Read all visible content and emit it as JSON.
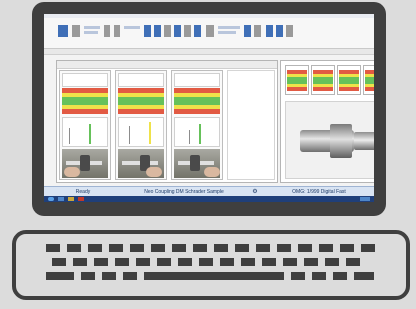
{
  "status_bar": {
    "ready": "Ready",
    "document": "Neo Coupling DM Schrader Sample",
    "instrument": "OMG: 1/999 Digital Fast"
  },
  "colors": {
    "laptop_frame": "#3f3f3f",
    "ribbon_accent": "#3f6fb7",
    "spc_red": "#e25a43",
    "spc_yellow": "#efe24a",
    "spc_green": "#66c15a",
    "taskbar": "#1f3f7a"
  },
  "icons": [
    "laptop",
    "keyboard",
    "caliper-photo",
    "part-photo",
    "windows-start"
  ]
}
